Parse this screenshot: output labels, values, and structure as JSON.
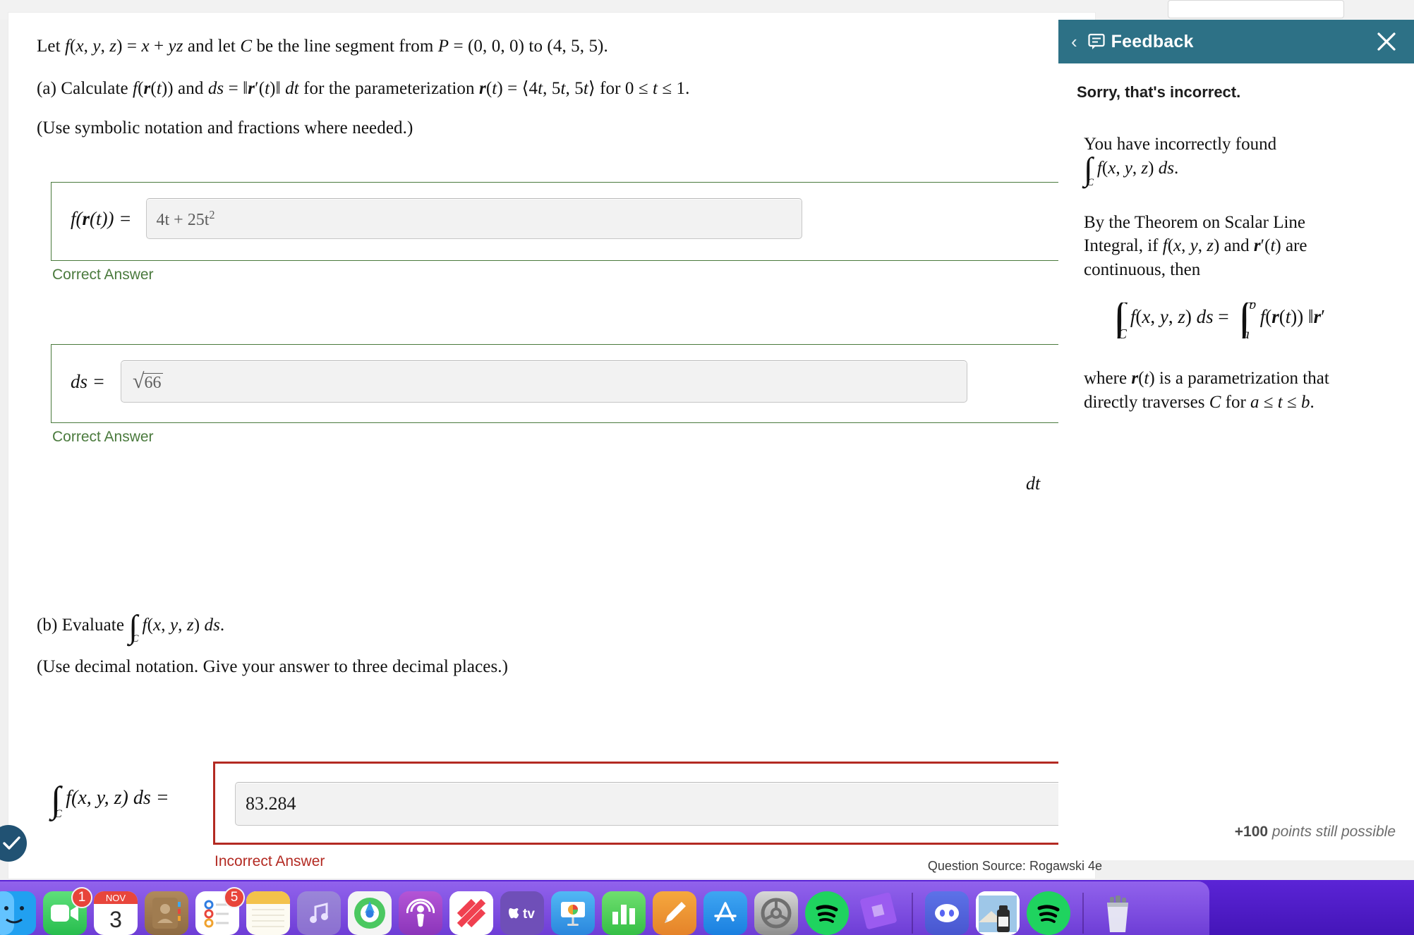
{
  "question": {
    "intro_prefix": "Let ",
    "intro_fn": "f(x, y, z) = x + yz",
    "intro_mid": " and let ",
    "intro_curve": "C",
    "intro_tail": " be the line segment from ",
    "intro_point": "P = (0, 0, 0)",
    "intro_to": " to ",
    "intro_end": "(4, 5, 5).",
    "part_a_label": "(a) Calculate ",
    "part_a_f": "f(r(t))",
    "part_a_and": " and ",
    "part_a_ds": "ds = ‖r′(t)‖ dt",
    "part_a_mid": " for the parameterization ",
    "part_a_r": "r(t) = ⟨4t, 5t, 5t⟩",
    "part_a_range": " for 0 ≤ t ≤ 1.",
    "note_a": "(Use symbolic notation and fractions where needed.)",
    "part_b_label": "(b) Evaluate ",
    "part_b_integral": "∫C f(x, y, z) ds.",
    "note_b": "(Use decimal notation. Give your answer to three decimal places.)",
    "source": "Question Source: Rogawski 4e"
  },
  "answers": {
    "a1": {
      "label": "f(r(t)) =",
      "value_main": "4t + 25t",
      "value_sup": "2",
      "verdict": "Correct Answer"
    },
    "a2": {
      "label": "ds =",
      "value_radicand": "66",
      "trailing_unit": "dt",
      "verdict": "Correct Answer"
    },
    "b1": {
      "label_integral_lower": "C",
      "label_rest": "f(x, y, z) ds =",
      "value": "83.284",
      "verdict": "Incorrect Answer"
    }
  },
  "feedback": {
    "title": "Feedback",
    "back_label": "‹",
    "close_label": "✕",
    "lead": "Sorry, that's incorrect.",
    "para1_line1": "You have incorrectly found",
    "para1_line2": "∫C f(x, y, z) ds.",
    "para2_line1": "By the Theorem on Scalar Line",
    "para2_line2": "Integral, if f(x, y, z) and r′(t) are",
    "para2_line3": "continuous, then",
    "equation_lhs": "f(x, y, z) ds  =",
    "equation_lower_lhs": "C",
    "equation_rhs": "f(r(t)) ‖r′",
    "equation_lower_rhs": "a",
    "equation_upper_rhs": "b",
    "para3_line1": "where r(t) is a parametrization that",
    "para3_line2": "directly traverses C for a ≤ t ≤ b.",
    "points_value": "+100",
    "points_text": "points still possible",
    "header_color": "#2d7186"
  },
  "dock": {
    "items": [
      {
        "name": "finder",
        "label": "Finder",
        "badge": null
      },
      {
        "name": "facetime",
        "label": "FaceTime",
        "badge": "1"
      },
      {
        "name": "calendar",
        "label": "Calendar",
        "badge": null,
        "month": "NOV",
        "day": "3"
      },
      {
        "name": "contacts",
        "label": "Contacts",
        "badge": null
      },
      {
        "name": "reminders",
        "label": "Reminders",
        "badge": "5"
      },
      {
        "name": "notes",
        "label": "Notes",
        "badge": null
      },
      {
        "name": "music",
        "label": "Music",
        "badge": null
      },
      {
        "name": "find-my",
        "label": "Find My",
        "badge": null
      },
      {
        "name": "podcasts",
        "label": "Podcasts",
        "badge": null
      },
      {
        "name": "news",
        "label": "News",
        "badge": null
      },
      {
        "name": "apple-tv",
        "label": "Apple TV",
        "badge": null
      },
      {
        "name": "keynote",
        "label": "Keynote",
        "badge": null
      },
      {
        "name": "numbers",
        "label": "Numbers",
        "badge": null
      },
      {
        "name": "pages",
        "label": "Pages",
        "badge": null
      },
      {
        "name": "app-store",
        "label": "App Store",
        "badge": null
      },
      {
        "name": "system-settings",
        "label": "System Settings",
        "badge": null
      },
      {
        "name": "spotify",
        "label": "Spotify",
        "badge": null
      },
      {
        "name": "roblox",
        "label": "Roblox",
        "badge": null
      },
      {
        "name": "discord",
        "label": "Discord",
        "badge": null
      },
      {
        "name": "photos-stack",
        "label": "Photos",
        "badge": null
      },
      {
        "name": "spotify-2",
        "label": "Spotify",
        "badge": null
      },
      {
        "name": "trash",
        "label": "Trash",
        "badge": null
      }
    ]
  }
}
